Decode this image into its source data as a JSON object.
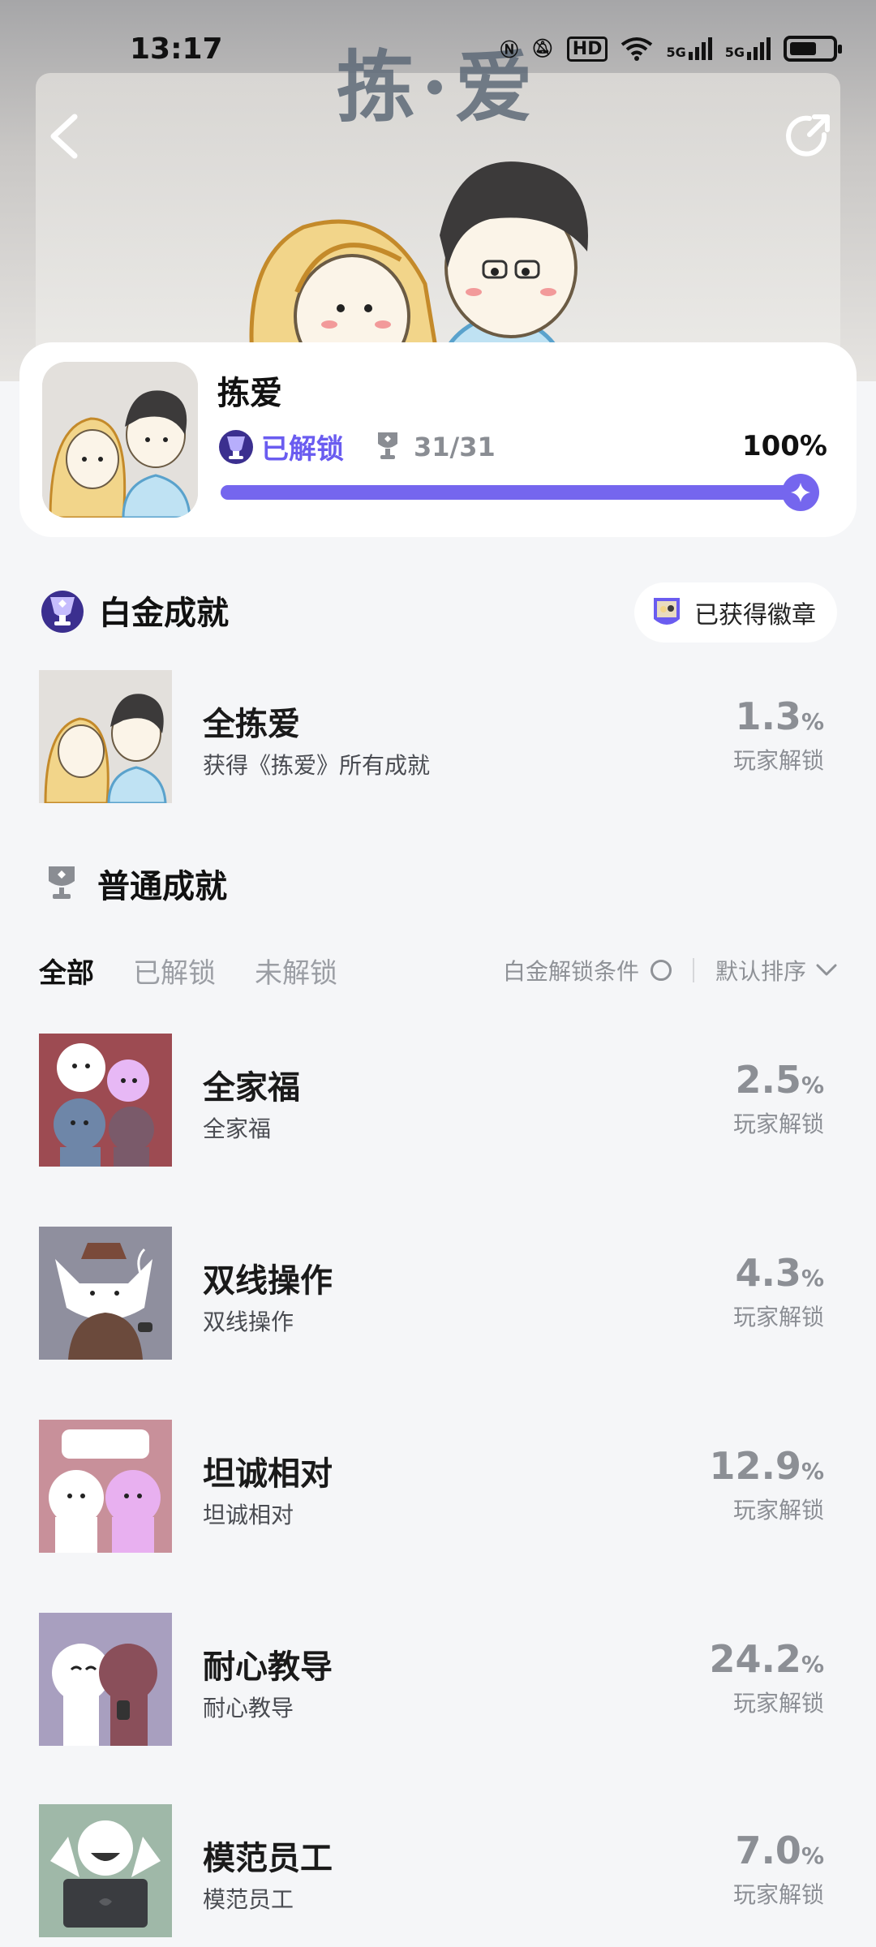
{
  "status_bar": {
    "time": "13:17",
    "icons": [
      "nfc-icon",
      "mute-icon",
      "hd-icon",
      "wifi-icon",
      "5g-signal-icon",
      "5g-signal-icon",
      "battery-icon"
    ],
    "hd_label": "HD",
    "net_label_1": "5G",
    "net_label_2": "5G"
  },
  "hero": {
    "title_art": "拣·爱"
  },
  "game": {
    "name": "拣爱",
    "unlock_status": "已解锁",
    "trophy_count": "31/31",
    "percent_text": "100%",
    "progress": 1.0
  },
  "platinum": {
    "section_title": "白金成就",
    "badge_chip": "已获得徽章",
    "item": {
      "title": "全拣爱",
      "desc": "获得《拣爱》所有成就",
      "rate": "1.3",
      "pct": "%",
      "rate_label": "玩家解锁"
    }
  },
  "normal": {
    "section_title": "普通成就",
    "tabs": [
      "全部",
      "已解锁",
      "未解锁"
    ],
    "filter_label": "白金解锁条件",
    "sort_label": "默认排序",
    "items": [
      {
        "title": "全家福",
        "desc": "全家福",
        "rate": "2.5",
        "pct": "%",
        "rate_label": "玩家解锁"
      },
      {
        "title": "双线操作",
        "desc": "双线操作",
        "rate": "4.3",
        "pct": "%",
        "rate_label": "玩家解锁"
      },
      {
        "title": "坦诚相对",
        "desc": "坦诚相对",
        "rate": "12.9",
        "pct": "%",
        "rate_label": "玩家解锁"
      },
      {
        "title": "耐心教导",
        "desc": "耐心教导",
        "rate": "24.2",
        "pct": "%",
        "rate_label": "玩家解锁"
      },
      {
        "title": "模范员工",
        "desc": "模范员工",
        "rate": "7.0",
        "pct": "%",
        "rate_label": "玩家解锁"
      }
    ]
  },
  "colors": {
    "accent": "#7566ee",
    "background": "#f5f6f8",
    "muted_text": "#8c8f95"
  }
}
